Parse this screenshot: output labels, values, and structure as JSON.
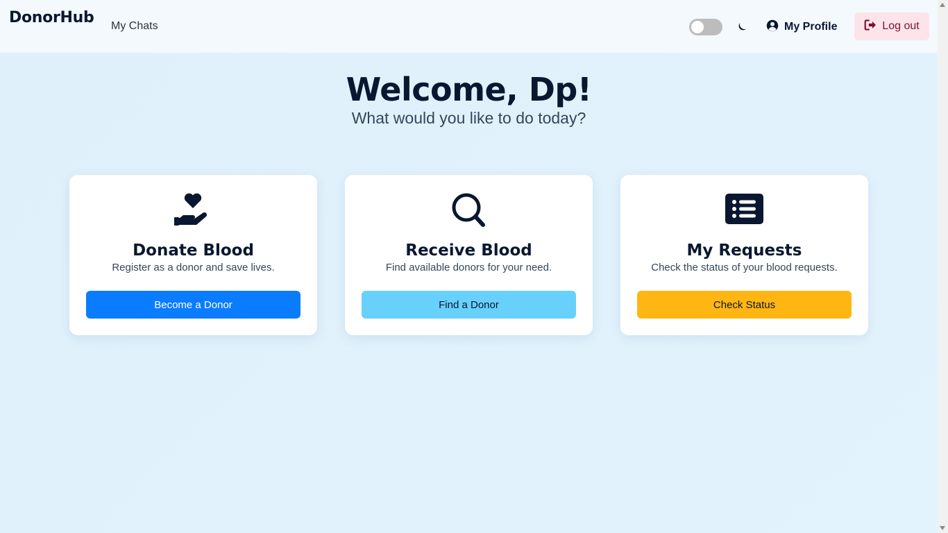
{
  "app": {
    "brand": "DonorHub"
  },
  "nav": {
    "links": [
      {
        "label": "My Chats",
        "icon": ""
      }
    ],
    "theme_toggle": {
      "state": "off"
    },
    "dark_mode_icon": "moon-icon",
    "profile": {
      "label": "My Profile",
      "icon": "user-circle-icon"
    },
    "logout": {
      "label": "Log out",
      "icon": "sign-out-icon"
    }
  },
  "hero": {
    "title": "Welcome, Dp!",
    "subtitle": "What would you like to do today?"
  },
  "cards": [
    {
      "icon": "hand-holding-heart-icon",
      "title": "Donate Blood",
      "description": "Register as a donor and save lives.",
      "button": "Become a Donor",
      "button_color": "#0a7cff",
      "button_text_color": "#ffffff"
    },
    {
      "icon": "search-icon",
      "title": "Receive Blood",
      "description": "Find available donors for your need.",
      "button": "Find a Donor",
      "button_color": "#67d0fb",
      "button_text_color": "#0a1730"
    },
    {
      "icon": "list-icon",
      "title": "My Requests",
      "description": "Check the status of your blood requests.",
      "button": "Check Status",
      "button_color": "#ffb612",
      "button_text_color": "#0a1730"
    }
  ],
  "colors": {
    "background": "#e0f1fc",
    "navbar": "#f4f9fd",
    "text_dark": "#0a1730",
    "logout_bg": "#fde4ea",
    "logout_text": "#7a1230"
  }
}
